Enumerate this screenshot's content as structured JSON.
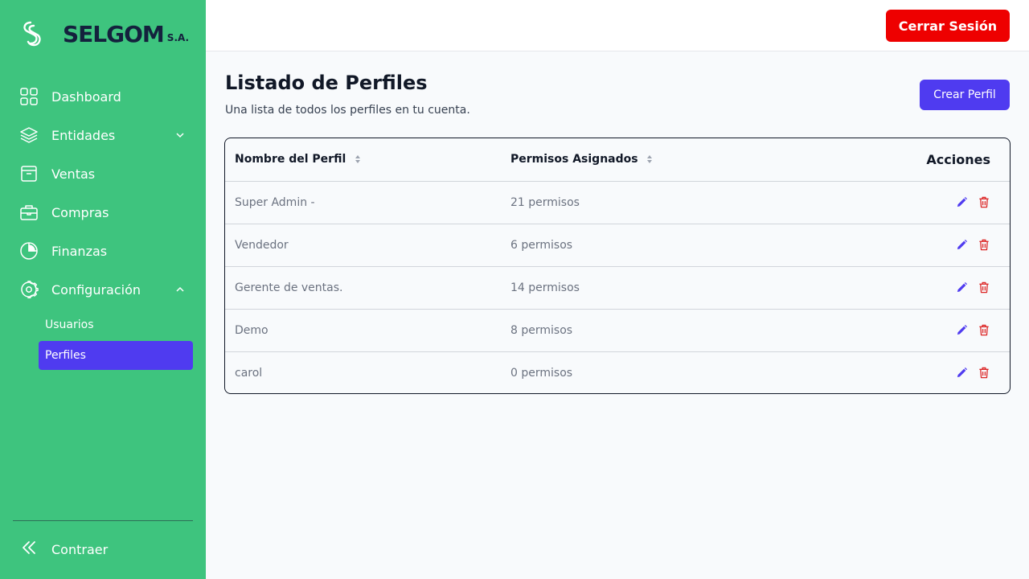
{
  "brand": {
    "name": "SELGOM",
    "suffix": "S.A."
  },
  "sidebar": {
    "items": [
      {
        "label": "Dashboard",
        "icon": "grid-icon"
      },
      {
        "label": "Entidades",
        "icon": "layers-icon",
        "chevron": "chevron-down-icon"
      },
      {
        "label": "Ventas",
        "icon": "archive-box-icon"
      },
      {
        "label": "Compras",
        "icon": "briefcase-icon"
      },
      {
        "label": "Finanzas",
        "icon": "pie-chart-icon"
      },
      {
        "label": "Configuración",
        "icon": "gear-icon",
        "chevron": "chevron-up-icon"
      }
    ],
    "sub_items": [
      {
        "label": "Usuarios",
        "active": false
      },
      {
        "label": "Perfiles",
        "active": true
      }
    ],
    "collapse_label": "Contraer"
  },
  "topbar": {
    "logout_label": "Cerrar Sesión",
    "logout_color": "#ee0000"
  },
  "main": {
    "title": "Listado de Perfiles",
    "subtitle": "Una lista de todos los perfiles en tu cuenta.",
    "create_label": "Crear Perfil",
    "accent_color": "#4f3bf0"
  },
  "table": {
    "headers": {
      "name": "Nombre del Perfil",
      "permissions": "Permisos Asignados",
      "actions": "Acciones"
    },
    "rows": [
      {
        "name": "Super Admin -",
        "permissions": "21 permisos"
      },
      {
        "name": "Vendedor",
        "permissions": "6 permisos"
      },
      {
        "name": "Gerente de ventas.",
        "permissions": "14 permisos"
      },
      {
        "name": "Demo",
        "permissions": "8 permisos"
      },
      {
        "name": "carol",
        "permissions": "0 permisos"
      }
    ]
  },
  "colors": {
    "sidebar_bg": "#3ec47e",
    "brand_text": "#14213d",
    "delete_red": "#dc2626"
  }
}
